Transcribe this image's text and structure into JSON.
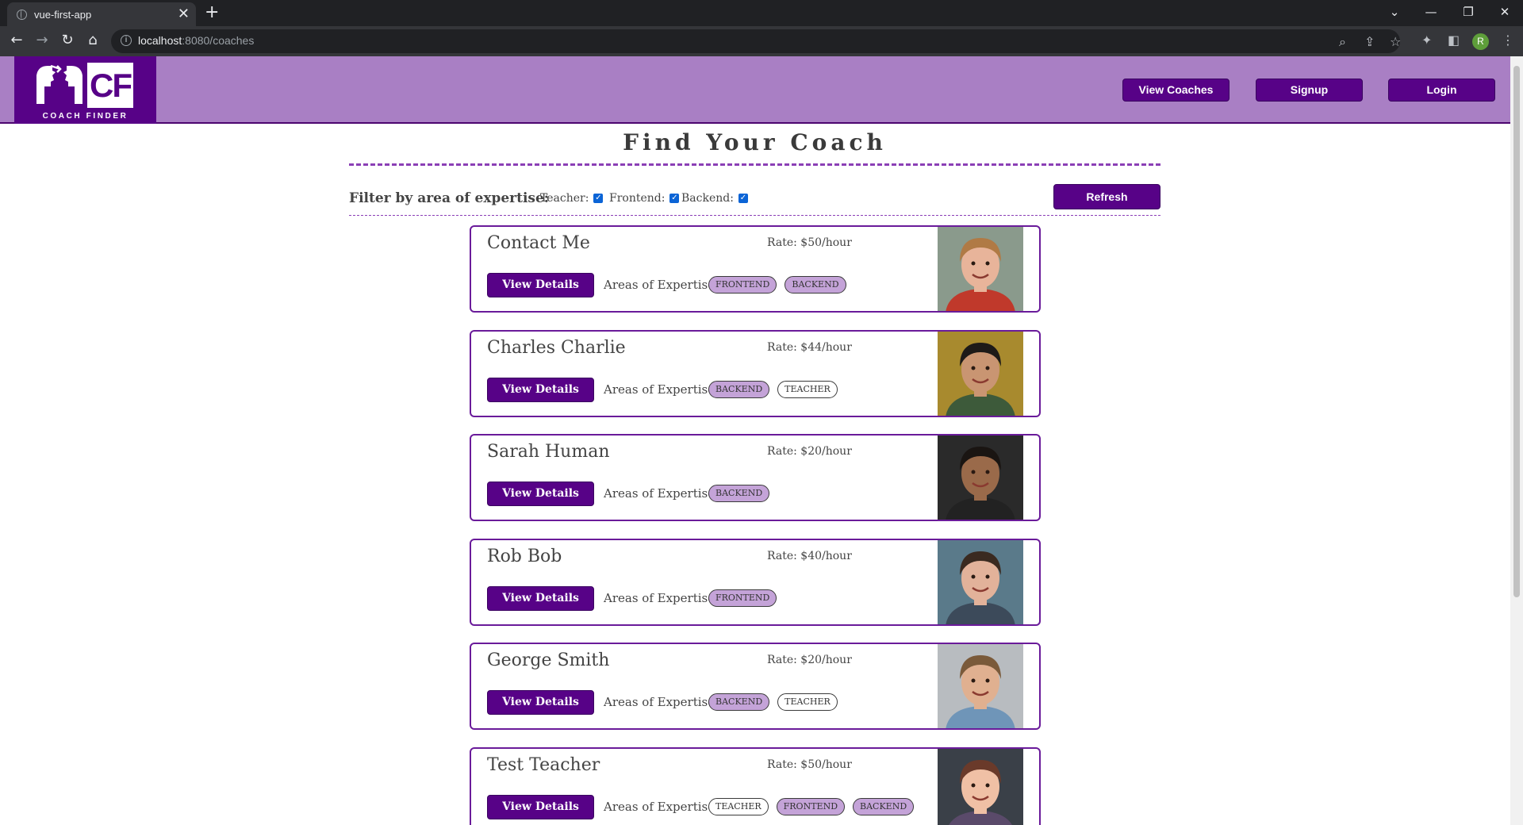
{
  "browser": {
    "tab_title": "vue-first-app",
    "tab_close": "✕",
    "new_tab": "+",
    "url_host": "localhost",
    "url_path": ":8080/coaches",
    "profile_initial": "R"
  },
  "header": {
    "logo_text": "COACH FINDER",
    "logo_mark": "CF",
    "nav": [
      "View Coaches",
      "Signup",
      "Login"
    ]
  },
  "main": {
    "title": "Find Your Coach",
    "filter_label": "Filter by area of expertise:",
    "filters": [
      {
        "label": "Teacher:",
        "checked": true
      },
      {
        "label": "Frontend:",
        "checked": true
      },
      {
        "label": "Backend:",
        "checked": true
      }
    ],
    "refresh_label": "Refresh",
    "details_label": "View Details",
    "areas_label": "Areas of Expertise:"
  },
  "coaches": [
    {
      "name": "Contact Me",
      "rate": "Rate: $50/hour",
      "areas": [
        "FRONTEND",
        "BACKEND"
      ]
    },
    {
      "name": "Charles Charlie",
      "rate": "Rate: $44/hour",
      "areas": [
        "BACKEND",
        "TEACHER"
      ]
    },
    {
      "name": "Sarah Human",
      "rate": "Rate: $20/hour",
      "areas": [
        "BACKEND"
      ]
    },
    {
      "name": "Rob Bob",
      "rate": "Rate: $40/hour",
      "areas": [
        "FRONTEND"
      ]
    },
    {
      "name": "George Smith",
      "rate": "Rate: $20/hour",
      "areas": [
        "BACKEND",
        "TEACHER"
      ]
    },
    {
      "name": "Test Teacher",
      "rate": "Rate: $50/hour",
      "areas": [
        "TEACHER",
        "FRONTEND",
        "BACKEND"
      ]
    }
  ],
  "photos": [
    {
      "bg": "#8a9a8c",
      "skin": "#e8b49a",
      "hair": "#b07a45",
      "shirt": "#c0392b"
    },
    {
      "bg": "#a88a2e",
      "skin": "#c99572",
      "hair": "#1d1a18",
      "shirt": "#3d5a3a"
    },
    {
      "bg": "#2a2a2a",
      "skin": "#9a6a4a",
      "hair": "#1a1512",
      "shirt": "#222222"
    },
    {
      "bg": "#5a7a8a",
      "skin": "#e2b29a",
      "hair": "#3a2a20",
      "shirt": "#3c4a5a"
    },
    {
      "bg": "#b8bcc0",
      "skin": "#e0b090",
      "hair": "#7a5a3a",
      "shirt": "#6f95b8"
    },
    {
      "bg": "#3a4048",
      "skin": "#f0c0a5",
      "hair": "#6a3a2a",
      "shirt": "#5a4a6a"
    }
  ],
  "colors": {
    "brand_purple": "#570287",
    "header_bg": "#a97fc4",
    "badge_fill": "#c4a3d8"
  }
}
